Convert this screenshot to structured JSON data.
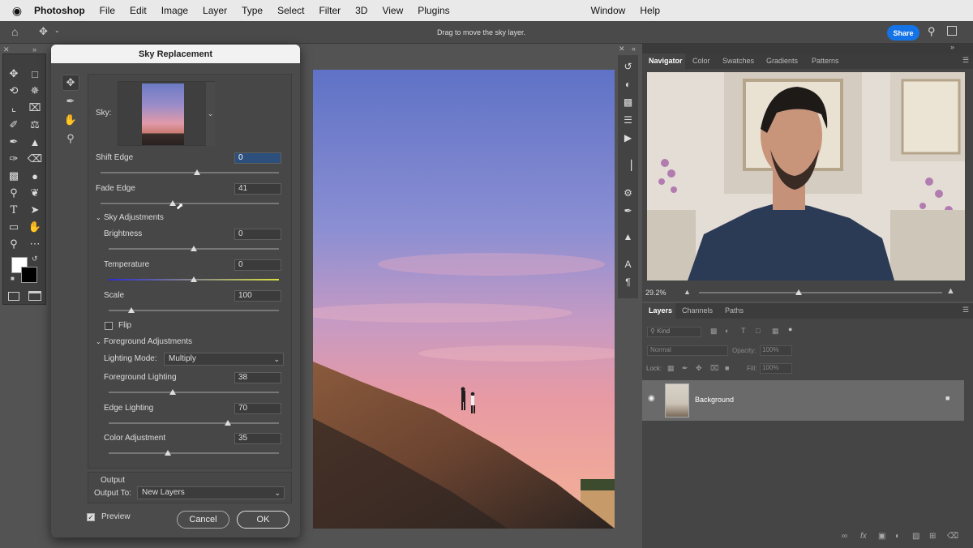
{
  "menubar": {
    "apple": "",
    "app_name": "Photoshop",
    "items": [
      "File",
      "Edit",
      "Image",
      "Layer",
      "Type",
      "Select",
      "Filter",
      "3D",
      "View",
      "Plugins"
    ],
    "right_items": [
      "Window",
      "Help"
    ]
  },
  "optbar": {
    "status": "Drag to move the sky layer.",
    "share": "Share"
  },
  "dialog": {
    "title": "Sky Replacement",
    "sky_label": "Sky:",
    "shift_edge": {
      "label": "Shift Edge",
      "value": "0"
    },
    "fade_edge": {
      "label": "Fade Edge",
      "value": "41"
    },
    "sky_adj": {
      "label": "Sky Adjustments",
      "brightness": {
        "label": "Brightness",
        "value": "0"
      },
      "temperature": {
        "label": "Temperature",
        "value": "0"
      },
      "scale": {
        "label": "Scale",
        "value": "100"
      },
      "flip": "Flip"
    },
    "fg_adj": {
      "label": "Foreground Adjustments",
      "lighting_mode_label": "Lighting Mode:",
      "lighting_mode_value": "Multiply",
      "fg_lighting": {
        "label": "Foreground Lighting",
        "value": "38"
      },
      "edge_lighting": {
        "label": "Edge Lighting",
        "value": "70"
      },
      "color_adj": {
        "label": "Color Adjustment",
        "value": "35"
      }
    },
    "output": {
      "label": "Output",
      "output_to_label": "Output To:",
      "output_to_value": "New Layers"
    },
    "preview": "Preview",
    "cancel": "Cancel",
    "ok": "OK"
  },
  "navigator": {
    "tabs": [
      "Navigator",
      "Color",
      "Swatches",
      "Gradients",
      "Patterns"
    ],
    "zoom": "29.2%"
  },
  "layers": {
    "tabs": [
      "Layers",
      "Channels",
      "Paths"
    ],
    "kind": "Kind",
    "blend": "Normal",
    "opacity_label": "Opacity:",
    "opacity_value": "100%",
    "lock_label": "Lock:",
    "fill_label": "Fill:",
    "fill_value": "100%",
    "layer_name": "Background"
  }
}
